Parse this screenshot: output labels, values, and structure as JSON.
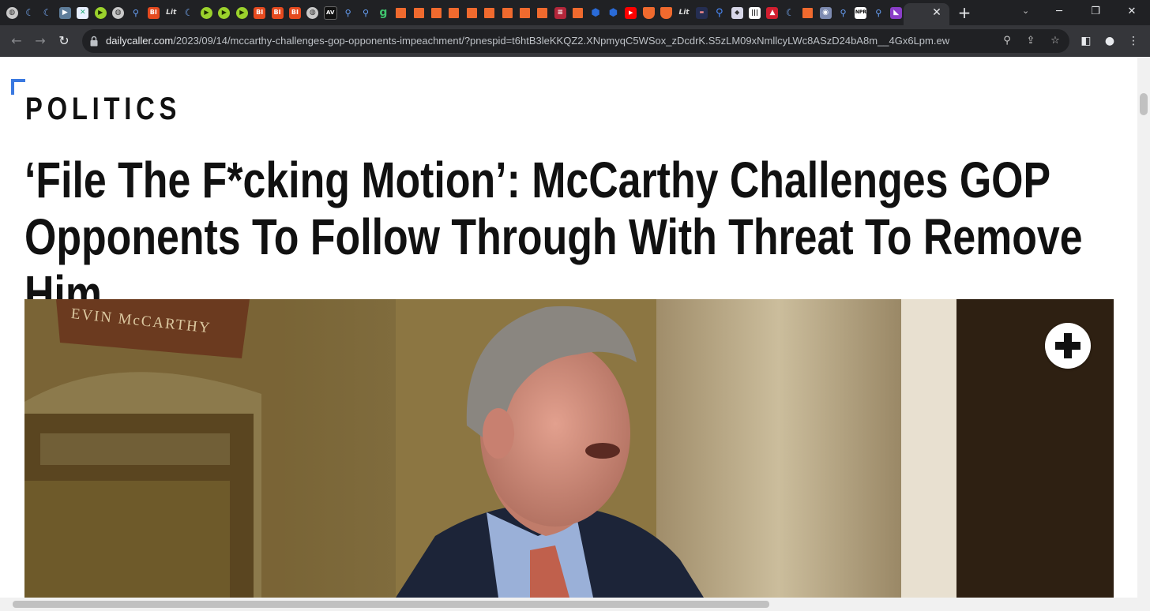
{
  "browser": {
    "tab_favicons": [
      {
        "name": "globe-icon",
        "cls": "globe",
        "glyph": "◍"
      },
      {
        "name": "moon-icon",
        "cls": "moon",
        "glyph": "☾"
      },
      {
        "name": "moon-icon",
        "cls": "moon",
        "glyph": "☾"
      },
      {
        "name": "arrow-icon",
        "cls": "arrow",
        "glyph": "▶"
      },
      {
        "name": "grid-icon",
        "cls": "grid",
        "glyph": "✕"
      },
      {
        "name": "play-icon",
        "cls": "play",
        "glyph": "▶"
      },
      {
        "name": "globe-icon",
        "cls": "globe",
        "glyph": "◍"
      },
      {
        "name": "search-icon",
        "cls": "search",
        "glyph": "⚲"
      },
      {
        "name": "bi-icon",
        "cls": "bi",
        "glyph": "BI"
      },
      {
        "name": "lit-icon",
        "cls": "lit",
        "glyph": "Lit"
      },
      {
        "name": "moon-icon",
        "cls": "moon",
        "glyph": "☾"
      },
      {
        "name": "play-icon",
        "cls": "play",
        "glyph": "▶"
      },
      {
        "name": "play-icon",
        "cls": "play",
        "glyph": "▶"
      },
      {
        "name": "play-icon",
        "cls": "play",
        "glyph": "▶"
      },
      {
        "name": "bi-icon",
        "cls": "bi",
        "glyph": "BI"
      },
      {
        "name": "bi-icon",
        "cls": "bi",
        "glyph": "BI"
      },
      {
        "name": "bi-icon",
        "cls": "bi",
        "glyph": "BI"
      },
      {
        "name": "globe-icon",
        "cls": "globe",
        "glyph": "◍"
      },
      {
        "name": "tag-icon",
        "cls": "tag",
        "glyph": "AV"
      },
      {
        "name": "search-icon",
        "cls": "search",
        "glyph": "⚲"
      },
      {
        "name": "search-icon",
        "cls": "search",
        "glyph": "⚲"
      },
      {
        "name": "g-icon",
        "cls": "g",
        "glyph": "g"
      },
      {
        "name": "bookmark-icon",
        "cls": "bookmark",
        "glyph": ""
      },
      {
        "name": "bookmark-icon",
        "cls": "bookmark",
        "glyph": ""
      },
      {
        "name": "bookmark-icon",
        "cls": "bookmark",
        "glyph": ""
      },
      {
        "name": "bookmark-icon",
        "cls": "bookmark",
        "glyph": ""
      },
      {
        "name": "bookmark-icon",
        "cls": "bookmark",
        "glyph": ""
      },
      {
        "name": "bookmark-icon",
        "cls": "bookmark",
        "glyph": ""
      },
      {
        "name": "bookmark-icon",
        "cls": "bookmark",
        "glyph": ""
      },
      {
        "name": "bookmark-icon",
        "cls": "bookmark",
        "glyph": ""
      },
      {
        "name": "bookmark-icon",
        "cls": "bookmark",
        "glyph": ""
      },
      {
        "name": "flag-icon",
        "cls": "flag",
        "glyph": "≡"
      },
      {
        "name": "bookmark-icon",
        "cls": "bookmark",
        "glyph": ""
      },
      {
        "name": "hex-icon",
        "cls": "hex",
        "glyph": "⬢"
      },
      {
        "name": "hex-icon",
        "cls": "hex",
        "glyph": "⬢"
      },
      {
        "name": "youtube-icon",
        "cls": "yt",
        "glyph": "▶"
      },
      {
        "name": "shield-icon",
        "cls": "shield",
        "glyph": ""
      },
      {
        "name": "shield-icon",
        "cls": "shield",
        "glyph": ""
      },
      {
        "name": "lit-icon",
        "cls": "lit",
        "glyph": "Lit"
      },
      {
        "name": "news-icon",
        "cls": "news",
        "glyph": "▬"
      },
      {
        "name": "magnify-icon",
        "cls": "magnify",
        "glyph": "⚲"
      },
      {
        "name": "crest-icon",
        "cls": "crest",
        "glyph": "◆"
      },
      {
        "name": "piano-icon",
        "cls": "piano",
        "glyph": "|||"
      },
      {
        "name": "red-icon",
        "cls": "red",
        "glyph": "▲"
      },
      {
        "name": "moon-icon",
        "cls": "moon",
        "glyph": "☾"
      },
      {
        "name": "bookmark-icon",
        "cls": "bookmark",
        "glyph": ""
      },
      {
        "name": "ghost-icon",
        "cls": "ghost",
        "glyph": "◉"
      },
      {
        "name": "search-icon",
        "cls": "search",
        "glyph": "⚲"
      },
      {
        "name": "npr-icon",
        "cls": "npr",
        "glyph": "NPR"
      },
      {
        "name": "search-icon",
        "cls": "search",
        "glyph": "⚲"
      },
      {
        "name": "violet-icon",
        "cls": "violet",
        "glyph": "◣"
      }
    ],
    "active_tab_close": "✕",
    "new_tab": "+",
    "tab_search": "⌄",
    "window": {
      "minimize": "─",
      "restore": "❐",
      "close": "✕"
    },
    "toolbar": {
      "back": "←",
      "forward": "→",
      "reload": "↻"
    },
    "url_host": "dailycaller.com",
    "url_path": "/2023/09/14/mccarthy-challenges-gop-opponents-impeachment/?pnespid=t6htB3leKKQZ2.XNpmyqC5WSox_zDcdrK.S5zLM09xNmllcyLWc8ASzD24bA8m__4Gx6Lpm.ew",
    "omni_icons": {
      "zoom": "⚲",
      "share": "⇪",
      "star": "☆"
    },
    "toolbar_icons": {
      "sidepanel": "◧",
      "profile": "●",
      "menu": "⋮"
    }
  },
  "article": {
    "section": "POLITICS",
    "headline": "‘File The F*cking Motion’: McCarthy Challenges GOP Opponents To Follow Through With Threat To Remove Him",
    "image_plaque": "EVIN McCARTHY"
  }
}
